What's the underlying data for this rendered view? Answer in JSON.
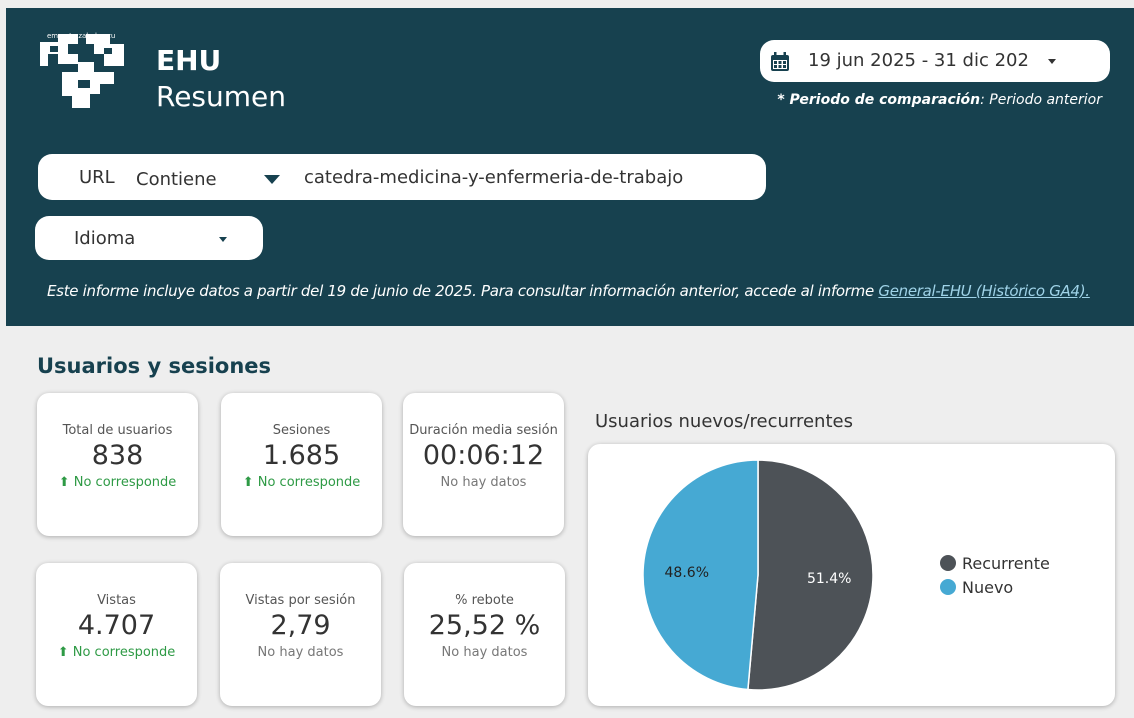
{
  "header": {
    "motto": "eman ta zabal zazu",
    "title": "EHU",
    "subtitle": "Resumen",
    "date_range": "19 jun 2025 - 31 dic 202",
    "comparison_label": "* Periodo de comparación",
    "comparison_value": ": Periodo anterior"
  },
  "filters": {
    "url_label": "URL",
    "url_operator": "Contiene",
    "url_value": "catedra-medicina-y-enfermeria-de-trabajo",
    "language_label": "Idioma"
  },
  "notice": {
    "text": "Este informe incluye datos a partir del 19 de junio de 2025. Para consultar información anterior, accede al informe ",
    "link": "General-EHU (Histórico GA4)."
  },
  "section": {
    "title": "Usuarios y sesiones"
  },
  "scorecards": [
    {
      "label": "Total de usuarios",
      "value": "838",
      "delta": "No corresponde"
    },
    {
      "label": "Sesiones",
      "value": "1.685",
      "delta": "No corresponde"
    },
    {
      "label": "Duración media sesión",
      "value": "00:06:12",
      "delta": "No hay datos"
    },
    {
      "label": "Vistas",
      "value": "4.707",
      "delta": "No corresponde"
    },
    {
      "label": "Vistas por sesión",
      "value": "2,79",
      "delta": "No hay datos"
    },
    {
      "label": "% rebote",
      "value": "25,52 %",
      "delta": "No hay datos"
    }
  ],
  "chart_data": {
    "type": "pie",
    "title": "Usuarios nuevos/recurrentes",
    "slices": [
      {
        "label": "Recurrente",
        "value": 51.4,
        "display": "51.4%",
        "color": "#4d5257"
      },
      {
        "label": "Nuevo",
        "value": 48.6,
        "display": "48.6%",
        "color": "#46a9d3"
      }
    ],
    "legend_position": "right"
  },
  "colors": {
    "header_bg": "#17414f",
    "positive": "#2e9a45",
    "link": "#9fd3e8"
  }
}
